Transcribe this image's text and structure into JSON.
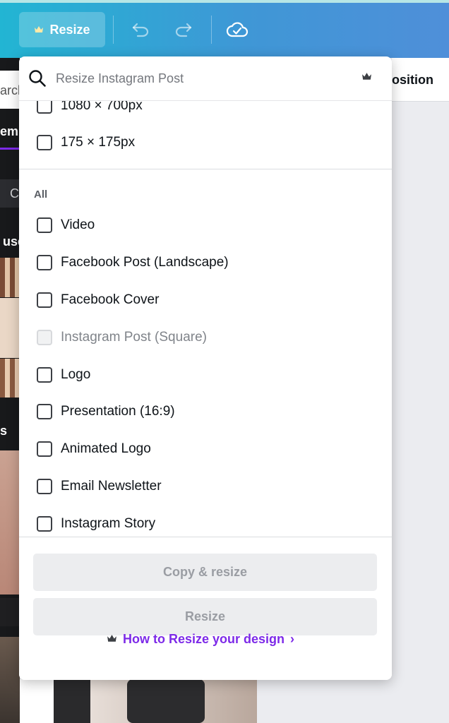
{
  "toolbar": {
    "resize_label": "Resize"
  },
  "background": {
    "left_search_fragment": "arch",
    "left_tab_fragment": "emp",
    "left_chip_fragment": "C",
    "left_section_fragment_1": "use",
    "left_section_fragment_2": "s",
    "right_tab_fragment": "osition"
  },
  "dropdown": {
    "search_placeholder": "Resize Instagram Post",
    "custom_sizes": [
      {
        "label": "1080 × 700px",
        "checked": false
      },
      {
        "label": "175 × 175px",
        "checked": false
      }
    ],
    "section_label": "All",
    "all_sizes": [
      {
        "label": "Video",
        "disabled": false
      },
      {
        "label": "Facebook Post (Landscape)",
        "disabled": false
      },
      {
        "label": "Facebook Cover",
        "disabled": false
      },
      {
        "label": "Instagram Post (Square)",
        "disabled": true
      },
      {
        "label": "Logo",
        "disabled": false
      },
      {
        "label": "Presentation (16:9)",
        "disabled": false
      },
      {
        "label": "Animated Logo",
        "disabled": false
      },
      {
        "label": "Email Newsletter",
        "disabled": false
      },
      {
        "label": "Instagram Story",
        "disabled": false
      }
    ],
    "copy_resize_label": "Copy & resize",
    "resize_label": "Resize",
    "help_link_label": "How to Resize your design",
    "help_chevron": "›"
  },
  "colors": {
    "accent_purple": "#7d2ae8",
    "toolbar_gradient_start": "#22b5d3",
    "toolbar_gradient_end": "#4f8fd9"
  }
}
